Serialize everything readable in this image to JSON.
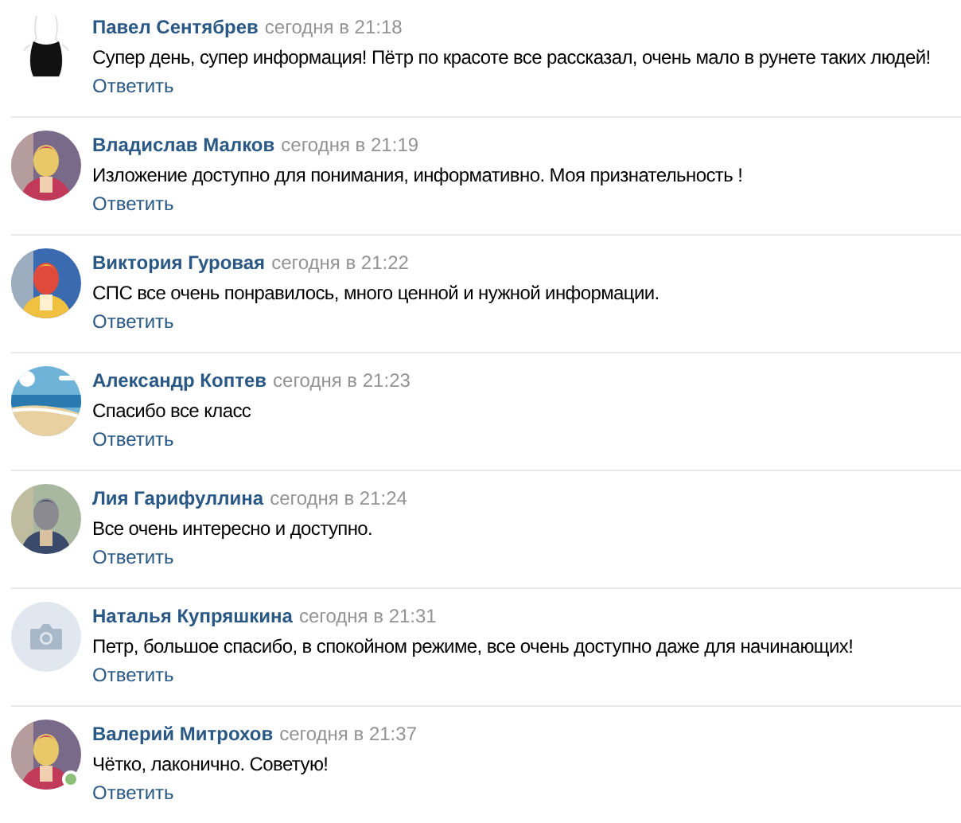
{
  "comments": [
    {
      "author": "Павел Сентябрев",
      "time": "сегодня в 21:18",
      "text": "Супер день, супер информация! Пётр по красоте все рассказал, очень мало в рунете таких людей!",
      "reply": "Ответить",
      "avatar": {
        "kind": "figure"
      },
      "online": false
    },
    {
      "author": "Владислав Малков",
      "time": "сегодня в 21:19",
      "text": "Изложение доступно для понимания, информативно. Моя признательность !",
      "reply": "Ответить",
      "online": false
    },
    {
      "author": "Виктория Гуровая",
      "time": "сегодня в 21:22",
      "text": "СПС все очень понравилось, много ценной и нужной информации.",
      "reply": "Ответить",
      "online": false
    },
    {
      "author": "Александр Коптев",
      "time": "сегодня в 21:23",
      "text": "Спасибо все класс",
      "reply": "Ответить",
      "online": false
    },
    {
      "author": "Лия Гарифуллина",
      "time": "сегодня в 21:24",
      "text": "Все очень интересно и доступно.",
      "reply": "Ответить",
      "online": false
    },
    {
      "author": "Наталья Купряшкина",
      "time": "сегодня в 21:31",
      "text": "Петр, большое спасибо, в спокойном режиме, все очень доступно даже для начинающих!",
      "reply": "Ответить",
      "avatar": {
        "kind": "camera"
      },
      "online": false
    },
    {
      "author": "Валерий Митрохов",
      "time": "сегодня в 21:37",
      "text": "Чётко, лаконично. Советую!",
      "reply": "Ответить",
      "online": true
    }
  ]
}
